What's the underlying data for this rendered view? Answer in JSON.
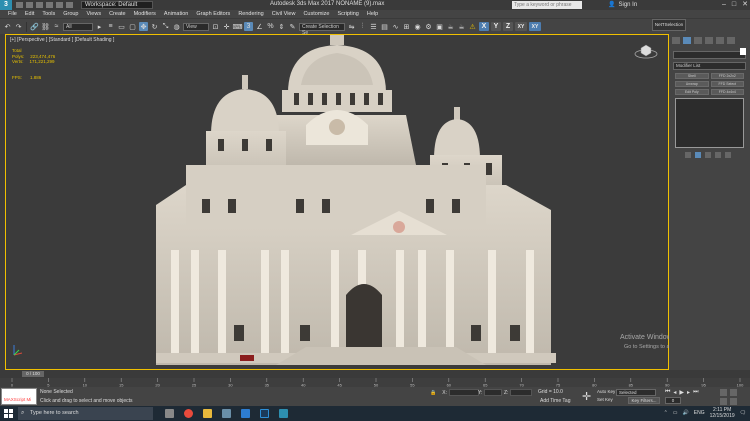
{
  "titlebar": {
    "logo": "3",
    "workspace": "Workspace: Default",
    "app_title": "Autodesk 3ds Max 2017    NONAME (9).max",
    "search_placeholder": "Type a keyword or phrase",
    "sign_in": "Sign In",
    "controls": [
      "–",
      "□",
      "✕"
    ]
  },
  "menu": [
    "File",
    "Edit",
    "Tools",
    "Group",
    "Views",
    "Create",
    "Modifiers",
    "Animation",
    "Graph Editors",
    "Rendering",
    "Civil View",
    "Customize",
    "Scripting",
    "Help"
  ],
  "toolbar": {
    "filter_dropdown": "All",
    "view_dropdown": "View",
    "selection_set": "Create Selection Se",
    "axis_x": "X",
    "axis_y": "Y",
    "axis_z": "Z",
    "axis_xy": "XY",
    "axis_xyz": "XY",
    "viewfinder": "NetTSelection"
  },
  "viewport": {
    "label": "[+] [Perspective ] [Standard ] [Default Shading ]",
    "stats_total_label": "Total",
    "stats_polys_label": "Polys:",
    "stats_polys_value": "223,474,476",
    "stats_verts_label": "Verts:",
    "stats_verts_value": "171,221,299",
    "fps_label": "FPS:",
    "fps_value": "1.886"
  },
  "watermark": {
    "line1": "Activate Windows",
    "line2": "Go to Settings to activate Windows."
  },
  "command_panel": {
    "list_label": "Modifier List",
    "buttons": [
      "Shell",
      "FFD 2x2x2",
      "Unwrap",
      "FFD Select",
      "Edit Poly",
      "FFD 4x4x4"
    ]
  },
  "timeline": {
    "thumb": "0 / 100",
    "ticks": [
      "0",
      "5",
      "10",
      "15",
      "20",
      "25",
      "30",
      "35",
      "40",
      "45",
      "50",
      "55",
      "60",
      "65",
      "70",
      "75",
      "80",
      "85",
      "90",
      "95",
      "100"
    ]
  },
  "statusbar": {
    "maxscript": "MAXScript Mi",
    "status_selection": "None Selected",
    "status_prompt": "Click and drag to select and move objects",
    "x_label": "X:",
    "y_label": "Y:",
    "z_label": "Z:",
    "grid": "Grid = 10.0",
    "add_time_tag": "Add Time Tag",
    "auto_key": "Auto Key",
    "set_key": "Set Key",
    "selected": "Selected",
    "key_filters": "Key Filters...",
    "frame": "0"
  },
  "taskbar": {
    "search": "Type here to search",
    "lang": "ENG",
    "time": "2:11 PM",
    "date": "12/15/2019"
  },
  "colors": {
    "accent": "#5a8ab8",
    "stats": "#e6c000",
    "viewport_bg": "#3b3b3b"
  }
}
